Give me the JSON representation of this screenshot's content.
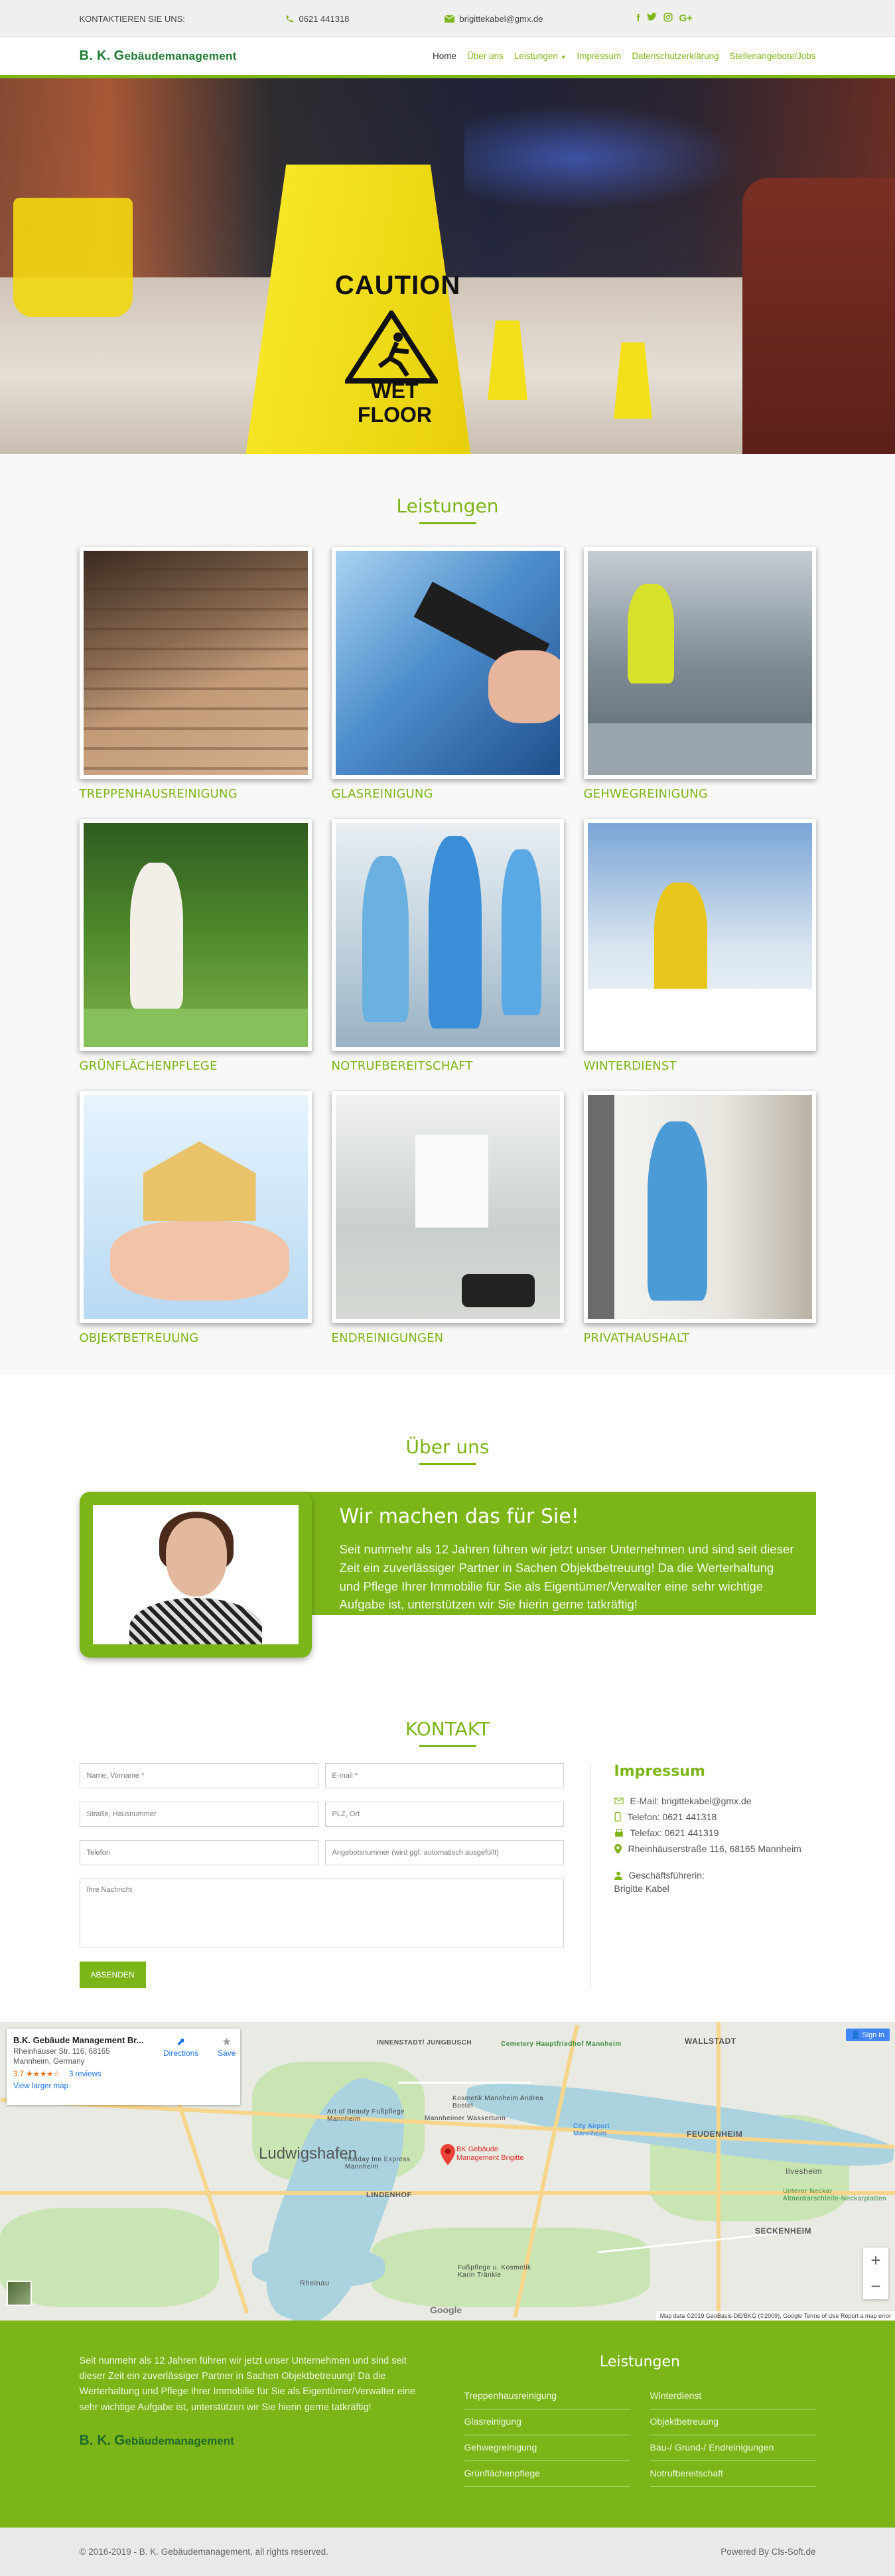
{
  "topbar": {
    "contact_label": "KONTAKTIEREN SIE UNS:",
    "phone": "0621 441318",
    "email": "brigittekabel@gmx.de",
    "social": [
      "f",
      "t",
      "ig",
      "G+"
    ]
  },
  "brand": {
    "initials": "B. K.",
    "first_letter": "G",
    "rest": "ebäudemanagement"
  },
  "nav": {
    "items": [
      "Home",
      "Über uns",
      "Leistungen",
      "Impressum",
      "Datenschutzerklärung",
      "Stellenangebote/Jobs"
    ]
  },
  "hero": {
    "caution": "CAUTION",
    "wet": "WET",
    "floor": "FLOOR"
  },
  "services": {
    "title": "Leistungen",
    "items": [
      "TREPPENHAUSREINIGUNG",
      "GLASREINIGUNG",
      "GEHWEGREINIGUNG",
      "GRÜNFLÄCHENPFLEGE",
      "NOTRUFBEREITSCHAFT",
      "WINTERDIENST",
      "OBJEKTBETREUUNG",
      "ENDREINIGUNGEN",
      "PRIVATHAUSHALT"
    ]
  },
  "about": {
    "title": "Über uns",
    "heading": "Wir machen das für Sie!",
    "text": "Seit nunmehr als 12 Jahren führen wir jetzt unser Unternehmen und sind seit dieser Zeit ein zuverlässiger Partner in Sachen Objektbetreuung! Da die Werterhaltung und Pflege Ihrer Immobilie für Sie als Eigentümer/Verwalter eine sehr wichtige Aufgabe ist, unterstützen wir Sie hierin gerne tatkräftig!"
  },
  "contact": {
    "title": "KONTAKT",
    "placeholders": {
      "name": "Name, Vorname *",
      "email": "E-mail *",
      "street": "Straße, Hausnummer",
      "zip": "PLZ, Ort",
      "phone": "Telefon",
      "offer": "Angebotsnummer (wird ggf. automatisch ausgefüllt)",
      "message": "Ihre Nachricht"
    },
    "submit": "ABSENDEN"
  },
  "impressum": {
    "title": "Impressum",
    "email": "E-Mail: brigittekabel@gmx.de",
    "phone": "Telefon: 0621 441318",
    "fax": "Telefax: 0621 441319",
    "address": "Rheinhäuserstraße 116, 68165 Mannheim",
    "ceo_label": "Geschäftsführerin:",
    "ceo_name": "Brigitte Kabel"
  },
  "map": {
    "place_name": "B.K. Gebäude Management Br...",
    "address_line1": "Rheinhäuser Str. 116, 68165",
    "address_line2": "Mannheim, Germany",
    "rating": "3.7",
    "stars": "★★★★☆",
    "reviews": "3 reviews",
    "view_larger": "View larger map",
    "directions": "Directions",
    "save": "Save",
    "signin": "Sign in",
    "pin_label_1": "BK Gebäude",
    "pin_label_2": "Management Brigitte",
    "labels": {
      "ludwigshafen": "Ludwigshafen",
      "wallstadt": "WALLSTADT",
      "feudenheim": "FEUDENHEIM",
      "neckarstadt": "INNENSTADT/ JUNGBUSCH",
      "lindenhof": "LINDENHOF",
      "seckenheim": "SECKENHEIM",
      "ilvesheim": "Ilvesheim",
      "kosmetik": "Kosmetik Mannheim Andrea Bostel",
      "wasserturm": "Mannheimer Wasserturm",
      "artbeauty": "Art of Beauty Fußpflege Mannheim",
      "hotel": "Holiday Inn Express Mannheim",
      "cityairport": "City Airport Mannheim",
      "neckar": "Unterer Neckar Altneckarschleife-Neckarplatten",
      "fusspflege": "Fußpflege u. Kosmetik Karin Tränkle",
      "rheinau": "Rheinau",
      "cemetery": "Cemetery Hauptfriedhof Mannheim"
    },
    "google": "Google",
    "footer": "Map data ©2019 GeoBasis-DE/BKG (©2009), Google   Terms of Use   Report a map error"
  },
  "footer": {
    "text": "Seit nunmehr als 12 Jahren führen wir jetzt unser Unternehmen und sind seit dieser Zeit ein zuverlässiger Partner in Sachen Objektbetreuung! Da die Werterhaltung und Pflege Ihrer Immobilie für Sie als Eigentümer/Verwalter eine sehr wichtige Aufgabe ist, unterstützen wir Sie hierin gerne tatkräftig!",
    "services_title": "Leistungen",
    "links": [
      "Treppenhausreinigung",
      "Winterdienst",
      "Glasreinigung",
      "Objektbetreuung",
      "Gehwegreinigung",
      "Bau-/ Grund-/ Endreinigungen",
      "Grünflächenpflege",
      "Notrufbereitschaft"
    ]
  },
  "copyright": {
    "left": "© 2016-2019 - B. K. Gebäudemanagement, all rights reserved.",
    "right": "Powered By Cls-Soft.de"
  },
  "colors": {
    "accent": "#7cb518",
    "logo": "#1d7a30"
  }
}
